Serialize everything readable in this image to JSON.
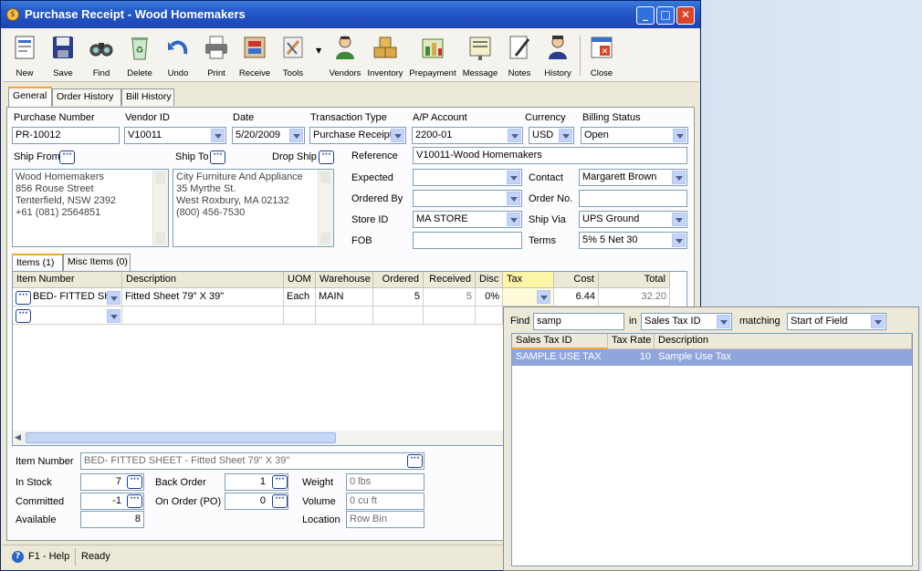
{
  "window": {
    "title": "Purchase Receipt - Wood Homemakers"
  },
  "toolbar": [
    {
      "label": "New",
      "icon": "new-document-icon"
    },
    {
      "label": "Save",
      "icon": "floppy-disk-icon"
    },
    {
      "label": "Find",
      "icon": "binoculars-icon"
    },
    {
      "label": "Delete",
      "icon": "recycle-bin-icon"
    },
    {
      "label": "Undo",
      "icon": "undo-arrow-icon"
    },
    {
      "label": "Print",
      "icon": "printer-icon"
    },
    {
      "label": "Receive",
      "icon": "receive-box-icon"
    },
    {
      "label": "Tools",
      "icon": "tools-icon"
    },
    {
      "label": "Vendors",
      "icon": "vendor-person-icon"
    },
    {
      "label": "Inventory",
      "icon": "inventory-boxes-icon"
    },
    {
      "label": "Prepayment",
      "icon": "prepayment-cash-icon"
    },
    {
      "label": "Message",
      "icon": "message-board-icon"
    },
    {
      "label": "Notes",
      "icon": "notes-pen-icon"
    },
    {
      "label": "History",
      "icon": "history-person-icon"
    },
    {
      "label": "Close",
      "icon": "close-window-icon"
    }
  ],
  "tabs": [
    "General",
    "Order History",
    "Bill History"
  ],
  "header": {
    "purchase_number_label": "Purchase Number",
    "purchase_number": "PR-10012",
    "vendor_id_label": "Vendor ID",
    "vendor_id": "V10011",
    "date_label": "Date",
    "date": "5/20/2009",
    "transaction_type_label": "Transaction Type",
    "transaction_type": "Purchase Receipt",
    "ap_account_label": "A/P Account",
    "ap_account": "2200-01",
    "currency_label": "Currency",
    "currency": "USD",
    "billing_status_label": "Billing Status",
    "billing_status": "Open"
  },
  "ship_from": {
    "label": "Ship From",
    "lines": [
      "Wood Homemakers",
      "856 Rouse Street",
      "Tenterfield, NSW 2392",
      "+61 (081) 2564851"
    ]
  },
  "ship_to": {
    "label": "Ship To",
    "lines": [
      "City Furniture And Appliance",
      "35 Myrthe St.",
      "West Roxbury, MA 02132",
      "(800) 456-7530"
    ]
  },
  "drop_ship_label": "Drop Ship",
  "details": {
    "reference_label": "Reference",
    "reference": "V10011-Wood Homemakers",
    "expected_label": "Expected",
    "expected": "",
    "ordered_by_label": "Ordered By",
    "ordered_by": "",
    "store_id_label": "Store ID",
    "store_id": "MA STORE",
    "fob_label": "FOB",
    "fob": "",
    "contact_label": "Contact",
    "contact": "Margarett Brown",
    "order_no_label": "Order No.",
    "order_no": "",
    "ship_via_label": "Ship Via",
    "ship_via": "UPS Ground",
    "terms_label": "Terms",
    "terms": "5% 5 Net 30"
  },
  "items_tabs": [
    "Items (1)",
    "Misc Items (0)"
  ],
  "grid": {
    "columns": [
      "Item Number",
      "Description",
      "UOM",
      "Warehouse",
      "Ordered",
      "Received",
      "Disc",
      "Tax",
      "Cost",
      "Total"
    ],
    "rows": [
      {
        "item_number": "BED- FITTED SHE",
        "description": "Fitted Sheet 79\" X 39\"",
        "uom": "Each",
        "warehouse": "MAIN",
        "ordered": "5",
        "received": "5",
        "disc": "0%",
        "tax": "",
        "cost": "6.44",
        "total": "32.20"
      }
    ]
  },
  "item_info": {
    "item_number_label": "Item Number",
    "item_number": "BED- FITTED SHEET - Fitted Sheet 79\" X 39\"",
    "in_stock_label": "In Stock",
    "in_stock": "7",
    "committed_label": "Committed",
    "committed": "-1",
    "available_label": "Available",
    "available": "8",
    "back_order_label": "Back Order",
    "back_order": "1",
    "on_order_label": "On Order (PO)",
    "on_order": "0",
    "weight_label": "Weight",
    "weight": "0 lbs",
    "volume_label": "Volume",
    "volume": "0 cu ft",
    "location_label": "Location",
    "location": "Row  Bin"
  },
  "status": {
    "help": "F1 - Help",
    "state": "Ready"
  },
  "lookup": {
    "find_label": "Find",
    "find_value": "samp",
    "in_label": "in",
    "in_field": "Sales Tax ID",
    "matching_label": "matching",
    "matching": "Start of Field",
    "columns": [
      "Sales Tax ID",
      "Tax Rate",
      "Description"
    ],
    "rows": [
      {
        "id": "SAMPLE USE TAX",
        "rate": "10",
        "description": "Sample Use Tax"
      }
    ]
  }
}
